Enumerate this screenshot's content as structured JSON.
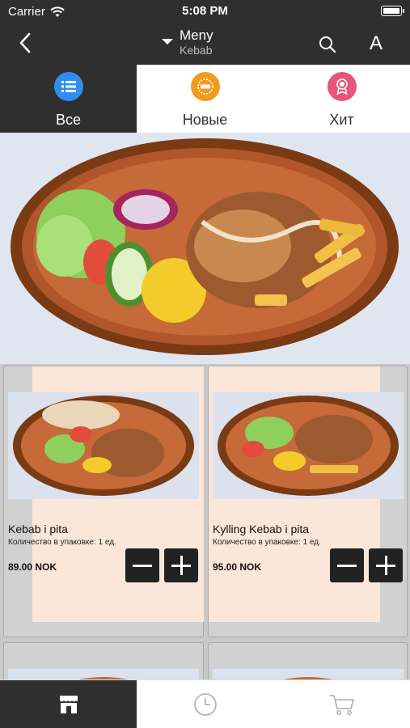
{
  "status_bar": {
    "carrier": "Carrier",
    "time": "5:08 PM"
  },
  "nav": {
    "title": "Meny",
    "subtitle": "Kebab",
    "font_button": "A"
  },
  "categories": [
    {
      "label": "Все",
      "icon": "list-icon",
      "color": "#2f8ef0",
      "active": true
    },
    {
      "label": "Новые",
      "icon": "new-badge-icon",
      "color": "#f39a1c",
      "active": false
    },
    {
      "label": "Хит",
      "icon": "award-ribbon-icon",
      "color": "#e7557a",
      "active": false
    }
  ],
  "products": [
    {
      "name": "Kebab i pita",
      "pack": "Количество в упаковке: 1 ед.",
      "price": "89.00 NOK"
    },
    {
      "name": "Kylling Kebab i pita",
      "pack": "Количество в упаковке: 1 ед.",
      "price": "95.00 NOK"
    }
  ],
  "bottom_tabs": [
    {
      "icon": "store-icon",
      "active": true
    },
    {
      "icon": "clock-icon",
      "active": false
    },
    {
      "icon": "cart-icon",
      "active": false
    }
  ]
}
